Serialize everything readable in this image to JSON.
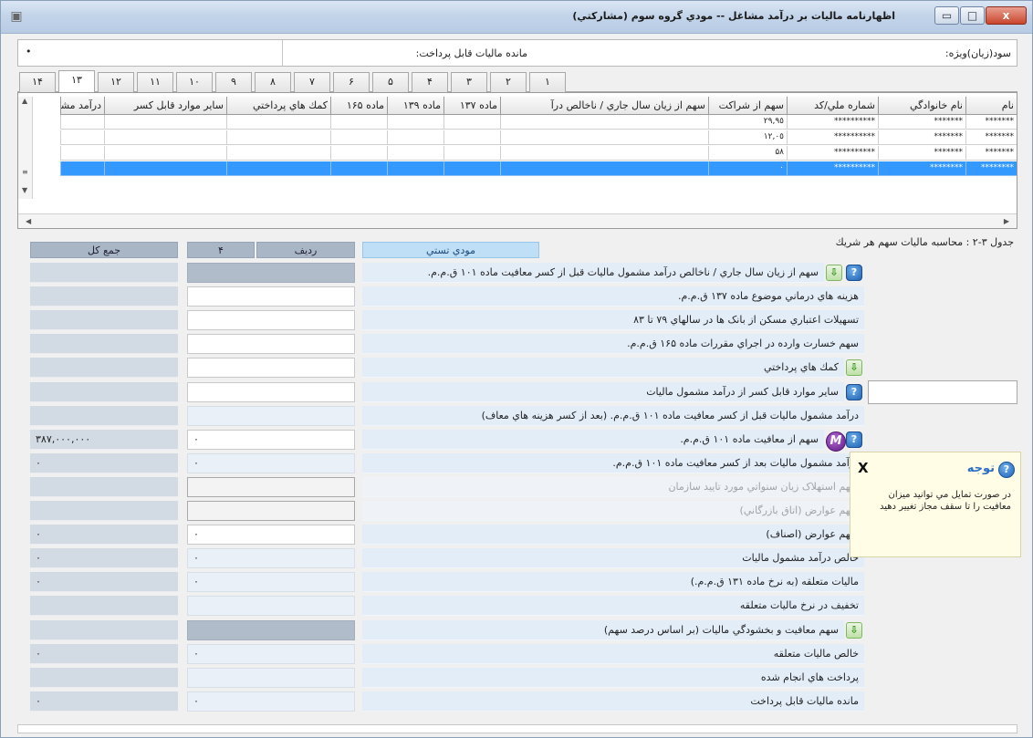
{
  "window": {
    "title": "اظهارنامه ماليات بر درآمد مشاغل -- مودي گروه سوم (مشاركتي)",
    "min_glyph": "▭",
    "max_glyph": "□",
    "close_glyph": "x"
  },
  "summary": {
    "special_profit_label": "سود(زيان)ويژه:",
    "payable_tax_label": "مانده ماليات قابل پرداخت:",
    "value_dot": "•"
  },
  "tabs": [
    "١",
    "٢",
    "٣",
    "۴",
    "۵",
    "۶",
    "٧",
    "٨",
    "٩",
    "١٠",
    "١١",
    "١٢",
    "١٣",
    "١۴"
  ],
  "active_tab_index": 12,
  "grid": {
    "columns": [
      "نام",
      "نام خانوادگي",
      "شماره ملي/كد",
      "سهم از شراكت",
      "سهم از زيان سال جاري / ناخالص درآ",
      "ماده ١٣٧",
      "ماده ١٣٩",
      "ماده ١۶۵",
      "كمك هاي پرداختي",
      "ساير موارد قابل كسر",
      "درآمد مشم"
    ],
    "rows": [
      [
        "*******",
        "*******",
        "**********",
        "٢٩,٩٥",
        "",
        "",
        "",
        "",
        "",
        "",
        ""
      ],
      [
        "*******",
        "*******",
        "**********",
        "١٢,٠٥",
        "",
        "",
        "",
        "",
        "",
        "",
        ""
      ],
      [
        "*******",
        "*******",
        "**********",
        "۵٨",
        "",
        "",
        "",
        "",
        "",
        "",
        ""
      ],
      [
        "********",
        "********",
        "**********",
        "٠",
        "",
        "",
        "",
        "",
        "",
        "",
        ""
      ]
    ],
    "selected_row": 3
  },
  "table_caption": "جدول ٣-٢ : محاسبه ماليات سهم هر شريك",
  "form": {
    "column_title": "مودي تستي",
    "row_label": "رديف",
    "row_number": "۴",
    "total_label": "جمع كل",
    "rows": [
      {
        "label": "سهم از زيان سال جاري / ناخالص درآمد مشمول ماليات قبل از كسر معافيت ماده ١٠١ ق.م.م.",
        "value": "",
        "total": "",
        "style": "gray",
        "disabled": false
      },
      {
        "label": "هزينه هاي درماني موضوع ماده ١٣٧ ق.م.م.",
        "value": "",
        "total": "",
        "style": "white",
        "disabled": false
      },
      {
        "label": "تسهيلات اعتباري مسكن از بانک ها در سالهاي ٧٩ تا ٨٣",
        "value": "",
        "total": "",
        "style": "white",
        "disabled": false
      },
      {
        "label": "سهم خسارت وارده در اجراي مقررات ماده ١۶۵ ق.م.م.",
        "value": "",
        "total": "",
        "style": "white",
        "disabled": false
      },
      {
        "label": "كمك هاي پرداختي",
        "value": "",
        "total": "",
        "style": "white",
        "disabled": false
      },
      {
        "label": "ساير موارد قابل كسر از درآمد مشمول ماليات",
        "value": "",
        "total": "",
        "style": "white",
        "disabled": false
      },
      {
        "label": "درآمد مشمول ماليات قبل از كسر معافيت ماده ١٠١ ق.م.م. (بعد از كسر هزينه هاي معاف)",
        "value": "",
        "total": "",
        "style": "light",
        "disabled": false
      },
      {
        "label": "سهم از معافيت ماده ١٠١ ق.م.م.",
        "value": "٠",
        "total": "٣٨٧,٠٠٠,٠٠٠",
        "style": "white",
        "disabled": false
      },
      {
        "label": "درآمد مشمول ماليات بعد از كسر معافيت ماده ١٠١ ق.م.م.",
        "value": "٠",
        "total": "٠",
        "style": "light",
        "disabled": false
      },
      {
        "label": "سهم استهلاک زيان سنواتي مورد تاييد سازمان",
        "value": "",
        "total": "",
        "style": "dis",
        "disabled": true
      },
      {
        "label": "سهم عوارض (اتاق بازرگاني)",
        "value": "",
        "total": "",
        "style": "dis",
        "disabled": true
      },
      {
        "label": "سهم عوارض (اصناف)",
        "value": "٠",
        "total": "٠",
        "style": "white",
        "disabled": false
      },
      {
        "label": "خالص درآمد مشمول ماليات",
        "value": "٠",
        "total": "٠",
        "style": "light",
        "disabled": false
      },
      {
        "label": "ماليات متعلقه (به نرخ ماده ١٣١ ق.م.م.)",
        "value": "٠",
        "total": "٠",
        "style": "light",
        "disabled": false
      },
      {
        "label": "تخفيف در نرخ ماليات متعلقه",
        "value": "",
        "total": "",
        "style": "light",
        "disabled": false
      },
      {
        "label": "سهم معافيت و بخشودگي ماليات (بر اساس درصد سهم)",
        "value": "",
        "total": "",
        "style": "gray",
        "disabled": false
      },
      {
        "label": "خالص ماليات متعلقه",
        "value": "٠",
        "total": "٠",
        "style": "light",
        "disabled": false
      },
      {
        "label": "پرداخت هاي انجام شده",
        "value": "",
        "total": "",
        "style": "light",
        "disabled": false
      },
      {
        "label": "مانده ماليات قابل پرداخت",
        "value": "٠",
        "total": "٠",
        "style": "light",
        "disabled": false
      }
    ]
  },
  "notice": {
    "title": "توجه",
    "close": "X",
    "body": "در صورت تمايل مي توانيد ميزان معافيت را تا سقف مجاز تغيير دهيد"
  },
  "icons": {
    "help": "?",
    "down": "⇩",
    "m": "M"
  }
}
